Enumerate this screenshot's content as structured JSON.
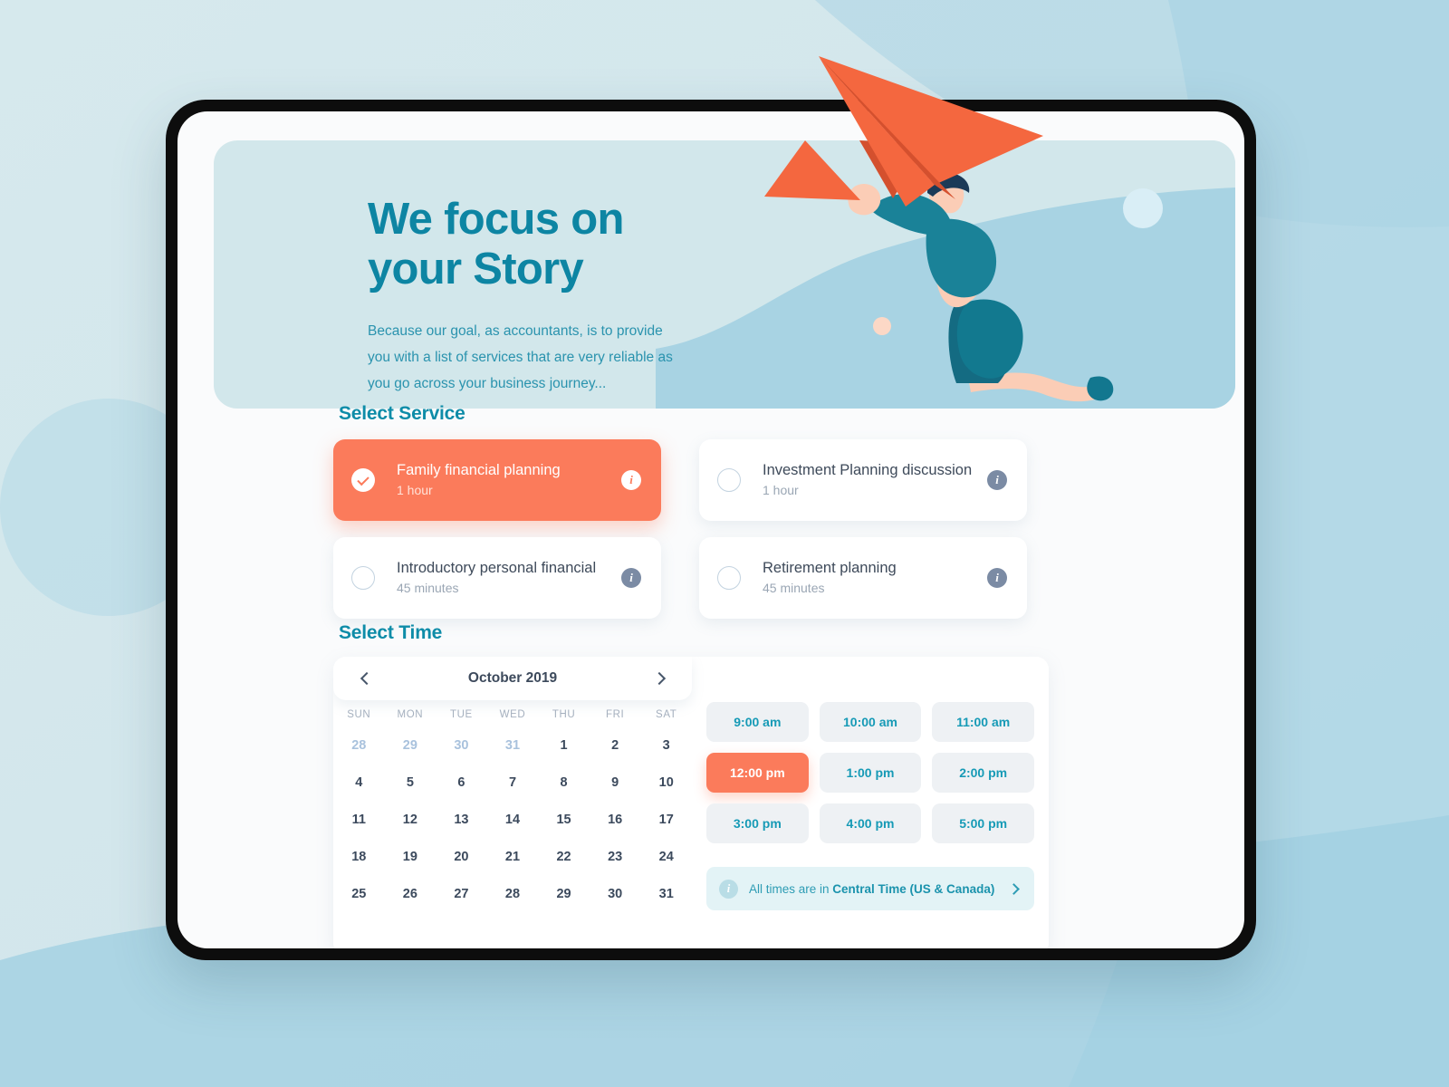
{
  "colors": {
    "accent_orange": "#fb7b5b",
    "teal": "#0e8ca8",
    "page_bg": "#d4e7ec",
    "hero_bg": "#d2e7eb",
    "wave_blue": "#a8d3e3"
  },
  "hero": {
    "title": "We focus on\nyour Story",
    "subtitle": "Because our goal, as accountants, is to provide you with a list of services that are very reliable as you go across your business journey..."
  },
  "service_section": {
    "title": "Select Service",
    "items": [
      {
        "name": "Family financial planning",
        "duration": "1 hour",
        "selected": true,
        "info": "i"
      },
      {
        "name": "Investment Planning discussion",
        "duration": "1 hour",
        "selected": false,
        "info": "i"
      },
      {
        "name": "Introductory personal financial",
        "duration": "45 minutes",
        "selected": false,
        "info": "i"
      },
      {
        "name": "Retirement planning",
        "duration": "45 minutes",
        "selected": false,
        "info": "i"
      }
    ]
  },
  "time_section": {
    "title": "Select Time",
    "calendar": {
      "month_label": "October 2019",
      "prev_icon": "chevron-left-icon",
      "next_icon": "chevron-right-icon",
      "weekdays": [
        "SUN",
        "MON",
        "TUE",
        "WED",
        "THU",
        "FRI",
        "SAT"
      ],
      "days": [
        {
          "n": "28",
          "muted": true
        },
        {
          "n": "29",
          "muted": true
        },
        {
          "n": "30",
          "muted": true
        },
        {
          "n": "31",
          "muted": true
        },
        {
          "n": "1",
          "muted": false
        },
        {
          "n": "2",
          "muted": false
        },
        {
          "n": "3",
          "muted": false
        },
        {
          "n": "4",
          "muted": false
        },
        {
          "n": "5",
          "muted": false
        },
        {
          "n": "6",
          "muted": false
        },
        {
          "n": "7",
          "muted": false
        },
        {
          "n": "8",
          "muted": false
        },
        {
          "n": "9",
          "muted": false
        },
        {
          "n": "10",
          "muted": false
        },
        {
          "n": "11",
          "muted": false
        },
        {
          "n": "12",
          "muted": false
        },
        {
          "n": "13",
          "muted": false
        },
        {
          "n": "14",
          "muted": false
        },
        {
          "n": "15",
          "muted": false
        },
        {
          "n": "16",
          "muted": false
        },
        {
          "n": "17",
          "muted": false
        },
        {
          "n": "18",
          "muted": false
        },
        {
          "n": "19",
          "muted": false
        },
        {
          "n": "20",
          "muted": false
        },
        {
          "n": "21",
          "muted": false
        },
        {
          "n": "22",
          "muted": false
        },
        {
          "n": "23",
          "muted": false
        },
        {
          "n": "24",
          "muted": false
        },
        {
          "n": "25",
          "muted": false
        },
        {
          "n": "26",
          "muted": false
        },
        {
          "n": "27",
          "muted": false
        },
        {
          "n": "28",
          "muted": false
        },
        {
          "n": "29",
          "muted": false
        },
        {
          "n": "30",
          "muted": false
        },
        {
          "n": "31",
          "muted": false
        }
      ]
    },
    "slots": [
      {
        "label": "9:00 am",
        "selected": false
      },
      {
        "label": "10:00 am",
        "selected": false
      },
      {
        "label": "11:00 am",
        "selected": false
      },
      {
        "label": "12:00 pm",
        "selected": true
      },
      {
        "label": "1:00 pm",
        "selected": false
      },
      {
        "label": "2:00 pm",
        "selected": false
      },
      {
        "label": "3:00 pm",
        "selected": false
      },
      {
        "label": "4:00 pm",
        "selected": false
      },
      {
        "label": "5:00 pm",
        "selected": false
      }
    ],
    "timezone": {
      "icon": "info-icon",
      "prefix": "All times are in ",
      "value": "Central Time (US & Canada)",
      "chevron": "chevron-right-icon"
    }
  }
}
